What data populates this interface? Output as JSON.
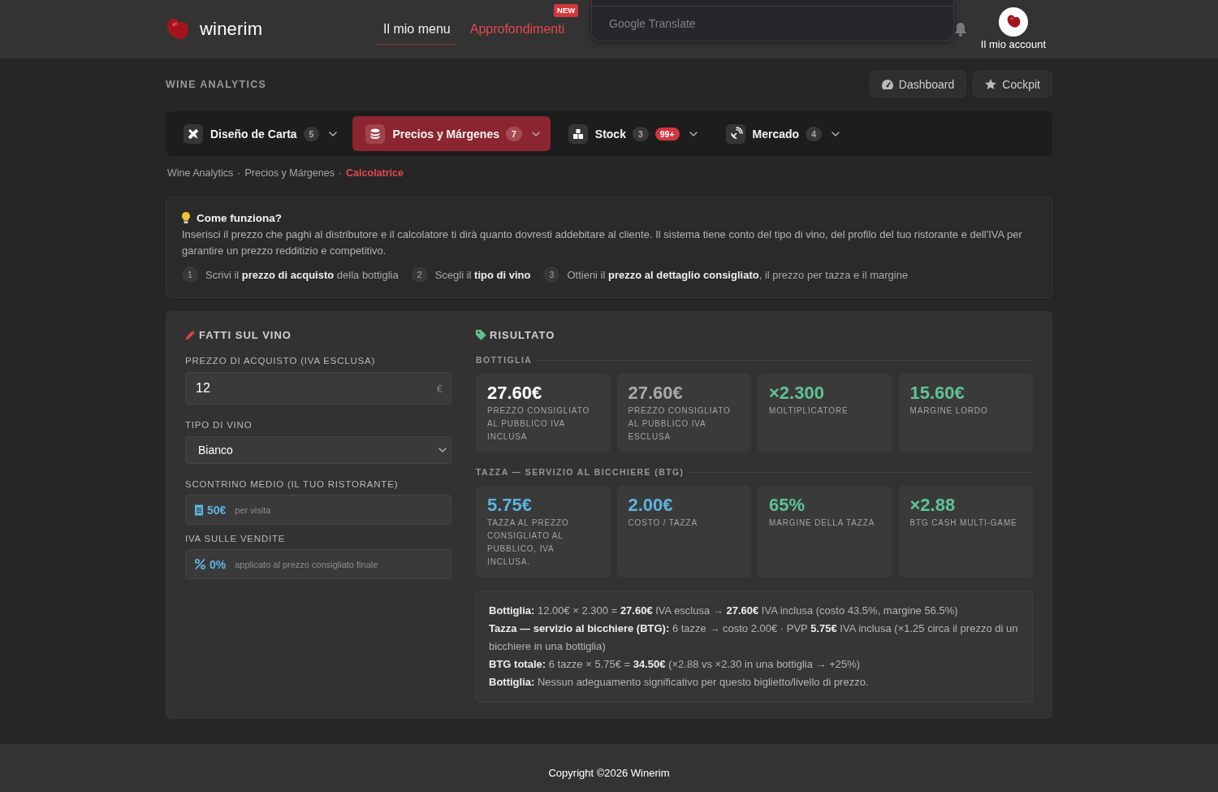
{
  "header": {
    "brand": "winerim",
    "nav": [
      {
        "label": "Il mio menu",
        "selected": true,
        "highlight": false
      },
      {
        "label": "Approfondimenti",
        "selected": false,
        "highlight": true,
        "badge": "NEW"
      }
    ],
    "translate": {
      "label": "Google Translate"
    },
    "account": {
      "label": "Il mio account"
    }
  },
  "page_title": "WINE ANALYTICS",
  "top_buttons": [
    {
      "label": "Dashboard"
    },
    {
      "label": "Cockpit"
    }
  ],
  "tabs": [
    {
      "label": "Diseño de Carta",
      "count": "5",
      "selected": false
    },
    {
      "label": "Precios y Márgenes",
      "count": "7",
      "selected": true
    },
    {
      "label": "Stock",
      "count": "3",
      "alert": "99+",
      "selected": false
    },
    {
      "label": "Mercado",
      "count": "4",
      "selected": false
    }
  ],
  "breadcrumb": {
    "separator": "·",
    "items": [
      {
        "label": "Wine Analytics",
        "selected": false
      },
      {
        "label": "Precios y Márgenes",
        "selected": false
      },
      {
        "label": "Calcolatrice",
        "selected": true
      }
    ]
  },
  "info": {
    "title": "Come funziona?",
    "text": "Inserisci il prezzo che paghi al distributore e il calcolatore ti dirà quanto dovresti addebitare al cliente. Il sistema tiene conto del tipo di vino, del profilo del tuo ristorante e dell'IVA per garantire un prezzo redditizio e competitivo.",
    "steps": [
      {
        "number": "1",
        "text": "Scrivi il **prezzo di acquisto** della bottiglia"
      },
      {
        "number": "2",
        "text": "Scegli il **tipo di vino**"
      },
      {
        "number": "3",
        "text": "Ottieni il **prezzo al dettaglio consigliato**, il prezzo per tazza e il margine"
      }
    ]
  },
  "form": {
    "title": "FATTI SUL VINO",
    "fields": [
      {
        "kind": "input",
        "label": "PREZZO DI ACQUISTO (IVA ESCLUSA)",
        "value": "12",
        "unit": "€"
      },
      {
        "kind": "select",
        "label": "TIPO DI VINO",
        "value": "Bianco"
      },
      {
        "kind": "info",
        "label": "SCONTRINO MEDIO (IL TUO RISTORANTE)",
        "value": "50€",
        "note": "per visita"
      },
      {
        "kind": "info",
        "label": "IVA SULLE VENDITE",
        "value": "0%",
        "note": "applicato al prezzo consigliato finale"
      }
    ]
  },
  "result": {
    "title": "RISULTATO",
    "sections": [
      {
        "title": "BOTTIGLIA",
        "cards": [
          {
            "value": "27.60€",
            "label": "PREZZO CONSIGLIATO AL PUBBLICO IVA INCLUSA",
            "color": "#ffffff"
          },
          {
            "value": "27.60€",
            "label": "PREZZO CONSIGLIATO AL PUBBLICO IVA ESCLUSA",
            "color": "#a9a9a9"
          },
          {
            "value": "×2.300",
            "label": "MOLTIPLICATORE",
            "color": "#5fc394"
          },
          {
            "value": "15.60€",
            "label": "MARGINE LORDO",
            "color": "#5fc394"
          }
        ]
      },
      {
        "title": "TAZZA — SERVIZIO AL BICCHIERE (BTG)",
        "cards": [
          {
            "value": "5.75€",
            "label": "TAZZA AL PREZZO CONSIGLIATO AL PUBBLICO, IVA INCLUSA.",
            "color": "#5cb3e0"
          },
          {
            "value": "2.00€",
            "label": "COSTO / TAZZA",
            "color": "#5cb3e0"
          },
          {
            "value": "65%",
            "label": "MARGINE DELLA TAZZA",
            "color": "#5fc394"
          },
          {
            "value": "×2.88",
            "label": "BTG CASH MULTI-GAME",
            "color": "#5fc394"
          }
        ]
      }
    ],
    "summary": [
      "**Bottiglia:** 12.00€ × 2.300 = **27.60€** IVA esclusa → **27.60€** IVA inclusa (costo 43.5%, margine 56.5%)",
      "**Tazza — servizio al bicchiere (BTG):** 6 tazze → costo 2.00€ · PVP **5.75€** IVA inclusa (×1.25 circa il prezzo di un bicchiere in una bottiglia)",
      "**BTG totale:** 6 tazze × 5.75€ = **34.50€** (×2.88 vs ×2.30 in una bottiglia → +25%)",
      "**Bottiglia:** Nessun adeguamento significativo per questo biglietto/livello di prezzo."
    ]
  },
  "footer": {
    "text": "Copyright ©2026 Winerim"
  }
}
